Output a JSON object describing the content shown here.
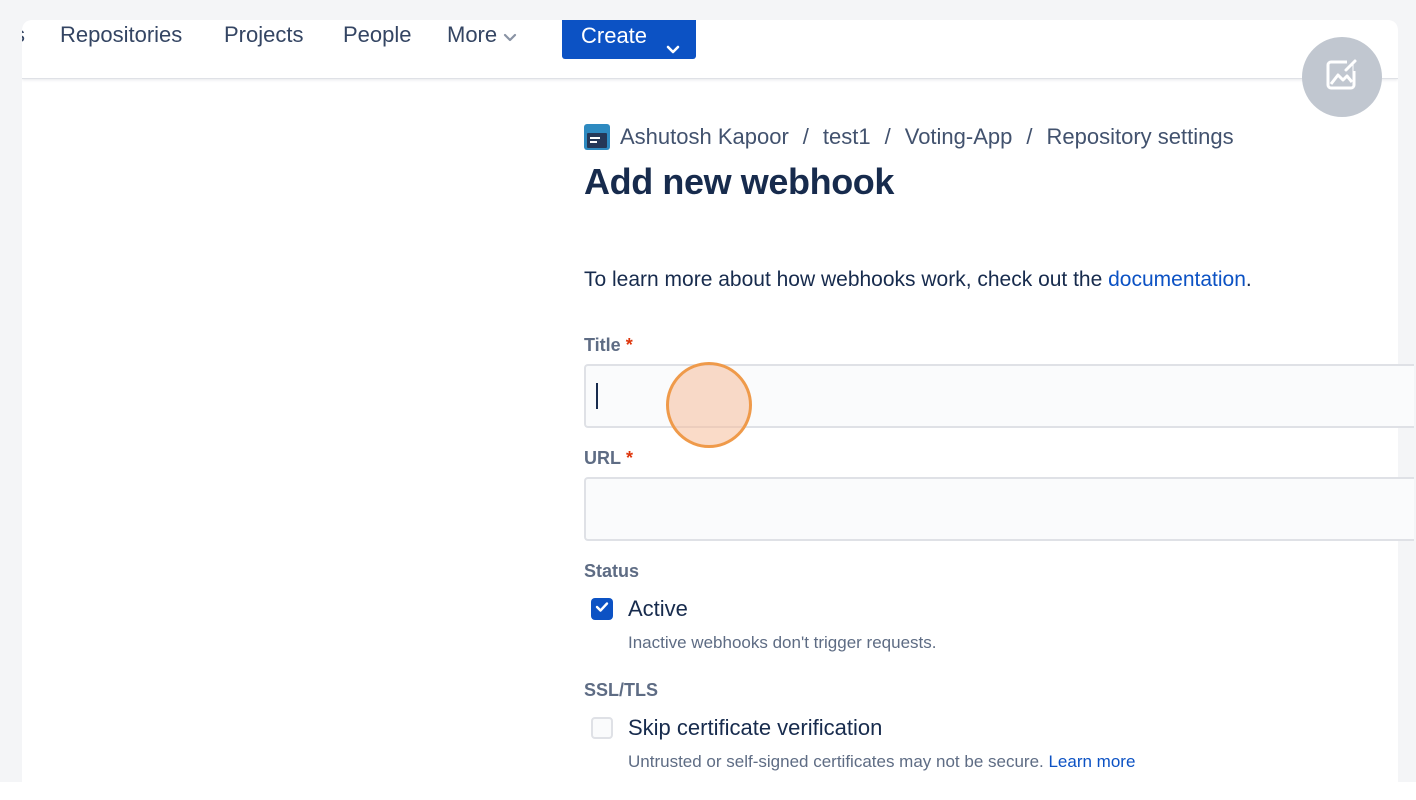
{
  "nav": {
    "cut_item": "s",
    "repositories": "Repositories",
    "projects": "Projects",
    "people": "People",
    "more": "More",
    "create": "Create"
  },
  "breadcrumb": {
    "owner": "Ashutosh Kapoor",
    "project": "test1",
    "repo": "Voting-App",
    "section": "Repository settings",
    "separator": "/"
  },
  "page": {
    "title": "Add new webhook",
    "intro_prefix": "To learn more about how webhooks work, check out the ",
    "intro_link": "documentation",
    "intro_suffix": "."
  },
  "form": {
    "title_label": "Title",
    "title_value": "",
    "url_label": "URL",
    "url_value": "",
    "required_marker": "*",
    "status_label": "Status",
    "active_label": "Active",
    "active_checked": true,
    "active_help": "Inactive webhooks don't trigger requests.",
    "ssl_label": "SSL/TLS",
    "skip_label": "Skip certificate verification",
    "skip_checked": false,
    "skip_help": "Untrusted or self-signed certificates may not be secure. ",
    "skip_help_link": "Learn more"
  },
  "colors": {
    "brand_blue": "#0c52c4",
    "required_red": "#de350b",
    "click_marker": "#ef9a4a"
  },
  "icons": {
    "repo": "repository-icon",
    "more": "chevron-down-icon",
    "create": "chevron-down-icon",
    "floating": "image-edit-icon",
    "checked": "checkmark-icon"
  }
}
